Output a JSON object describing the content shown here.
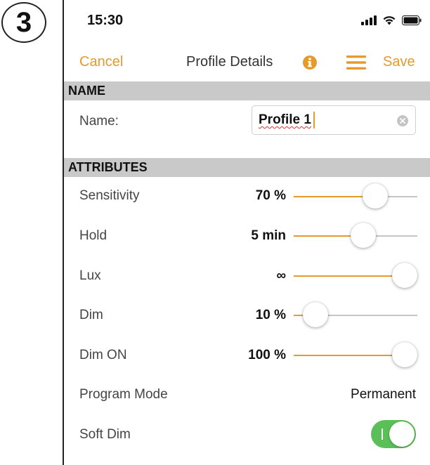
{
  "step_badge": "3",
  "status_bar": {
    "time": "15:30"
  },
  "nav": {
    "cancel_label": "Cancel",
    "title": "Profile Details",
    "save_label": "Save"
  },
  "sections": {
    "name_header": "NAME",
    "attributes_header": "ATTRIBUTES"
  },
  "name_row": {
    "label": "Name:",
    "value": "Profile 1"
  },
  "attributes": [
    {
      "label": "Sensitivity",
      "value": "70 %",
      "level": 0.7
    },
    {
      "label": "Hold",
      "value": "5 min",
      "level": 0.58
    },
    {
      "label": "Lux",
      "value": "∞",
      "level": 1.0
    },
    {
      "label": "Dim",
      "value": "10 %",
      "level": 0.09
    },
    {
      "label": "Dim ON",
      "value": "100 %",
      "level": 1.0
    }
  ],
  "program_mode": {
    "label": "Program Mode",
    "value": "Permanent"
  },
  "soft_dim": {
    "label": "Soft Dim",
    "enabled": true
  },
  "colors": {
    "accent": "#e69a2a",
    "section_header_bg": "#c9c9c9",
    "toggle_on": "#5bbf57"
  }
}
